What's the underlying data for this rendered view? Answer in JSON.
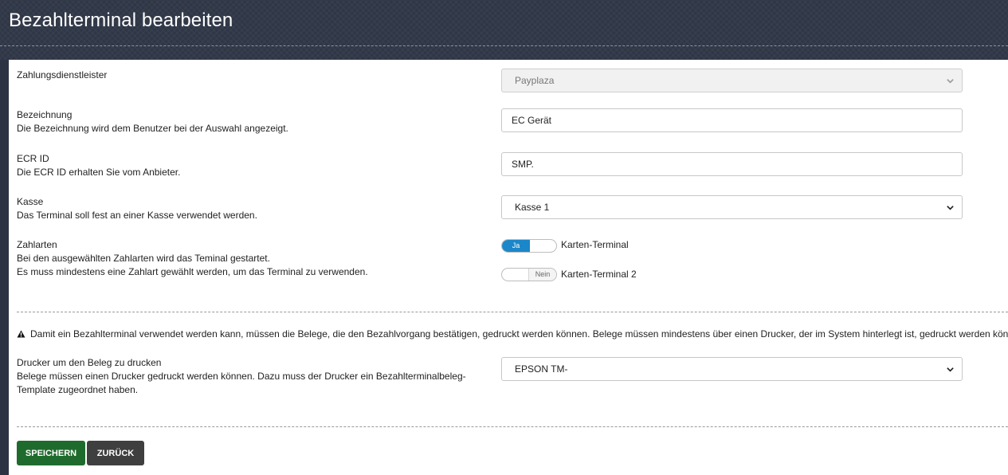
{
  "header": {
    "title": "Bezahlterminal bearbeiten"
  },
  "form": {
    "provider": {
      "title": "Zahlungsdienstleister",
      "value": "Payplaza"
    },
    "name": {
      "title": "Bezeichnung",
      "desc": "Die Bezeichnung wird dem Benutzer bei der Auswahl angezeigt.",
      "value": "EC Gerät"
    },
    "ecr": {
      "title": "ECR ID",
      "desc": "Die ECR ID erhalten Sie vom Anbieter.",
      "value": "SMP."
    },
    "register": {
      "title": "Kasse",
      "desc": "Das Terminal soll fest an einer Kasse verwendet werden.",
      "value": "Kasse 1"
    },
    "payment_types": {
      "title": "Zahlarten",
      "desc1": "Bei den ausgewählten Zahlarten wird das Teminal gestartet.",
      "desc2": "Es muss mindestens eine Zahlart gewählt werden, um das Terminal zu verwenden.",
      "items": [
        {
          "label": "Karten-Terminal",
          "state": "Ja"
        },
        {
          "label": "Karten-Terminal 2",
          "state": "Nein"
        }
      ]
    },
    "warning": "Damit ein Bezahlterminal verwendet werden kann, müssen die Belege, die den Bezahlvorgang bestätigen, gedruckt werden können. Belege müssen mindestens über einen Drucker, der im System hinterlegt ist, gedruckt werden können.",
    "printer": {
      "title": "Drucker um den Beleg zu drucken",
      "desc1": "Belege müssen einen Drucker gedruckt werden können. Dazu muss der Drucker ein Bezahlterminalbeleg-",
      "desc2": "Template zugeordnet haben.",
      "value": "EPSON TM-"
    }
  },
  "buttons": {
    "save": "SPEICHERN",
    "back": "ZURÜCK"
  },
  "colors": {
    "header_bg": "#2f3646",
    "toggle_on": "#1b87c9",
    "save_button": "#1f6b2d",
    "back_button": "#3f3f3f"
  }
}
